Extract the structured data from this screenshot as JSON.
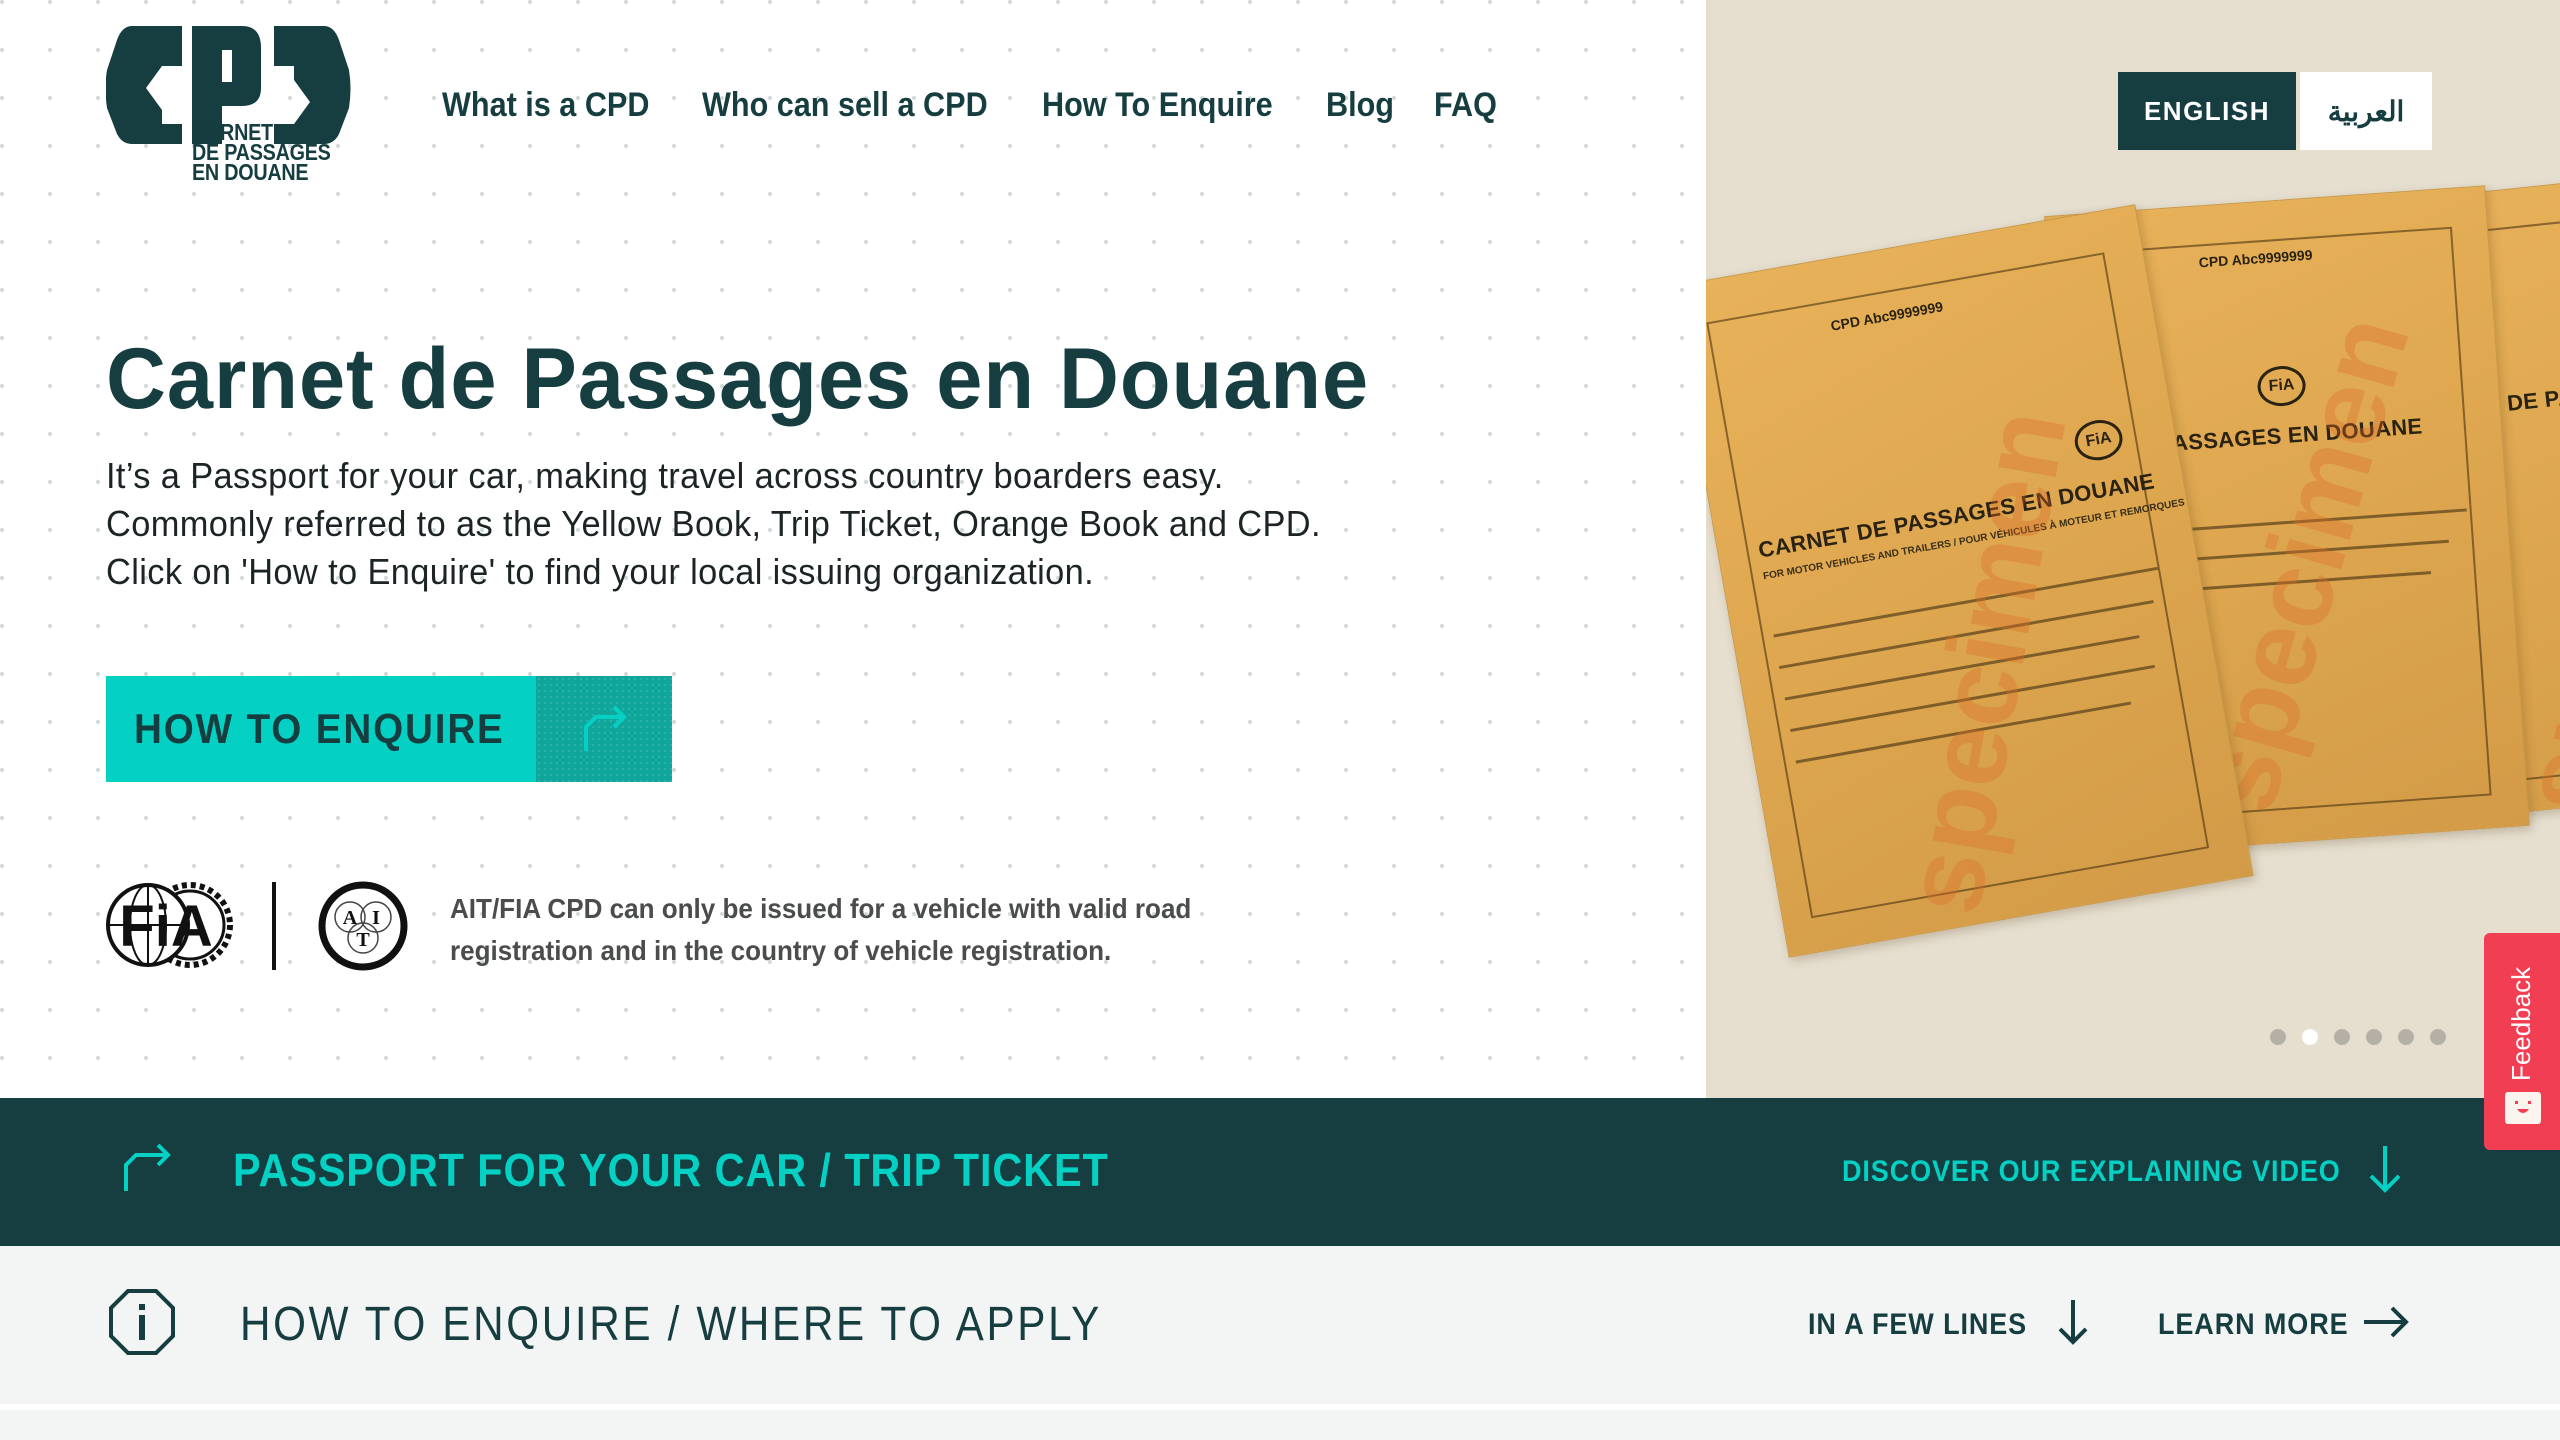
{
  "brand": {
    "logo_text": "CPD",
    "logo_sub": [
      "CARNET",
      "DE PASSAGES",
      "EN DOUANE"
    ],
    "colors": {
      "primary": "#163d3f",
      "accent": "#04d1c4",
      "accent_dark": "#11a69c",
      "panel": "#e6dfd0",
      "feedback": "#f23e52"
    }
  },
  "nav": {
    "items": [
      {
        "label": "What is a CPD"
      },
      {
        "label": "Who can sell a CPD"
      },
      {
        "label": "How To Enquire"
      },
      {
        "label": "Blog"
      },
      {
        "label": "FAQ"
      }
    ]
  },
  "language": {
    "options": [
      {
        "label": "ENGLISH",
        "active": true
      },
      {
        "label": "العربية",
        "active": false
      }
    ]
  },
  "hero": {
    "title": "Carnet de Passages en Douane",
    "lead": [
      "It’s a Passport for your car, making travel across country boarders easy.",
      "Commonly referred to as the Yellow Book, Trip Ticket, Orange Book and CPD.",
      "Click on 'How to Enquire' to find your local issuing organization."
    ],
    "cta_label": "HOW TO ENQUIRE",
    "cta_icon": "turn-right-arrow-icon",
    "notice": [
      "AIT/FIA CPD can only be issued for a vehicle with valid road",
      "registration and in the country of vehicle registration."
    ],
    "logos": {
      "fia": "FiA",
      "ait": [
        "A",
        "I",
        "T"
      ]
    }
  },
  "carousel": {
    "image_alt": "Carnet de Passages en Douane documents",
    "document_title": "CARNET DE PASSAGES EN DOUANE",
    "document_subtitle": "FOR MOTOR VEHICLES AND TRAILERS / POUR VÉHICULES À MOTEUR ET REMORQUES",
    "document_number": "CPD Abc9999999",
    "watermark": "specimen",
    "slide_count": 6,
    "active_slide": 2
  },
  "sections": {
    "passport": {
      "title": "PASSPORT FOR YOUR CAR / TRIP TICKET",
      "link": "DISCOVER OUR EXPLAINING VIDEO"
    },
    "enquire": {
      "title": "HOW TO ENQUIRE / WHERE TO APPLY",
      "link_lines": "IN A FEW LINES",
      "link_more": "LEARN MORE"
    }
  },
  "feedback": {
    "label": "Feedback"
  }
}
